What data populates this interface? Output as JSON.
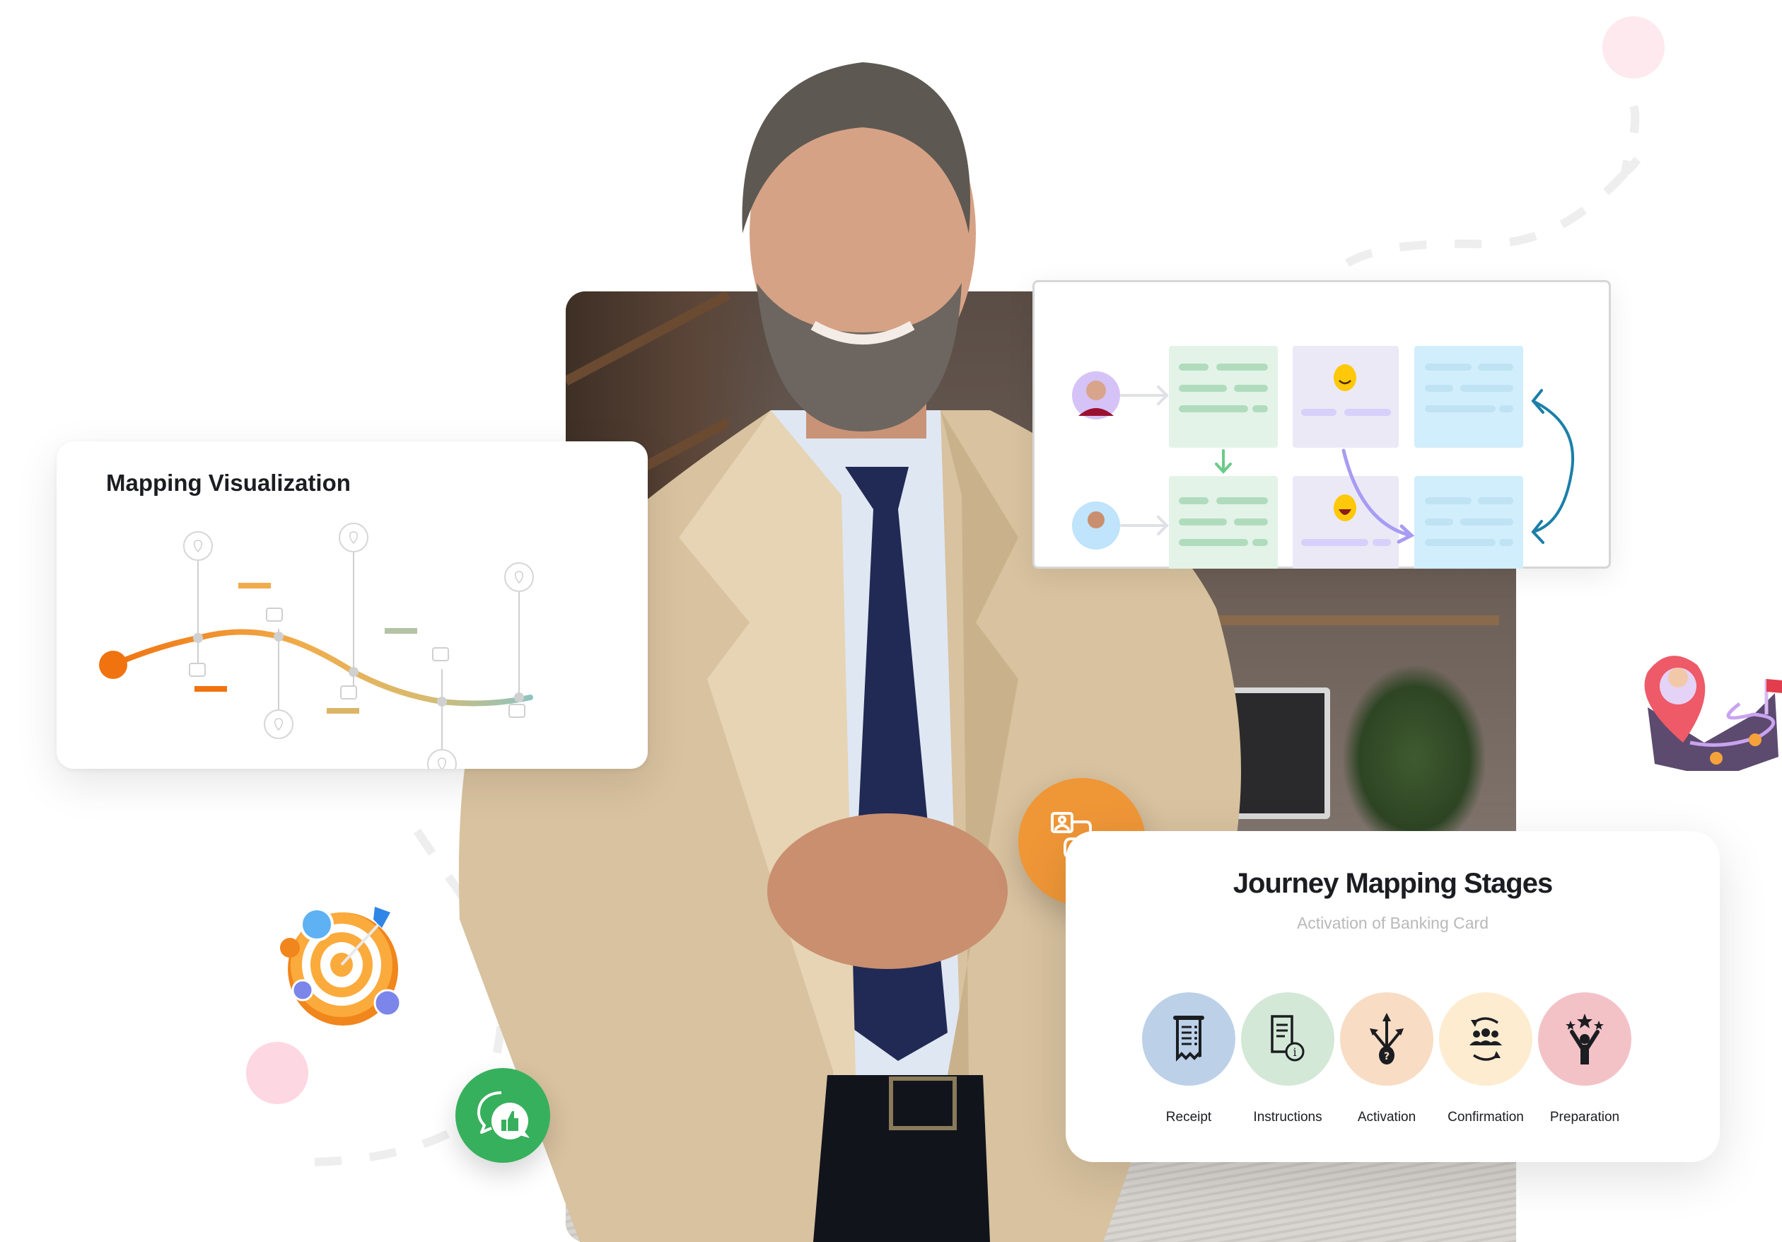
{
  "mapping_card": {
    "title": "Mapping Visualization",
    "accent_start": "#f07310",
    "accent_mid": "#f0ac4a",
    "accent_end": "#8fc3c0"
  },
  "journey_card": {
    "title": "Journey Mapping Stages",
    "subtitle": "Activation of Banking Card",
    "stages": [
      {
        "label": "Receipt",
        "icon": "receipt-icon",
        "color": "#bcd1e8"
      },
      {
        "label": "Instructions",
        "icon": "document-info-icon",
        "color": "#d3e8d6"
      },
      {
        "label": "Activation",
        "icon": "decision-arrows-icon",
        "color": "#f8dcc4"
      },
      {
        "label": "Confirmation",
        "icon": "team-cycle-icon",
        "color": "#fdecd0"
      },
      {
        "label": "Preparation",
        "icon": "celebrate-stars-icon",
        "color": "#f3c2c7"
      }
    ]
  },
  "diagram_card": {
    "rows": [
      {
        "persona": "woman-avatar",
        "persona_bg": "#d5c3f7",
        "emoji": "smile-emoji"
      },
      {
        "persona": "man-avatar",
        "persona_bg": "#bfe4fb",
        "emoji": "laugh-emoji"
      }
    ],
    "column_colors": [
      "#e3f3e8",
      "#ebe9f6",
      "#d1eefc"
    ]
  },
  "badges": {
    "journey_icon": "journey-path-icon",
    "journey_color": "#ef9637",
    "feedback_icon": "chat-thumbs-up-icon",
    "feedback_color": "#37b05d"
  },
  "decor": {
    "dot_color": "#fde4ea",
    "dash_color": "#eeeeee"
  }
}
